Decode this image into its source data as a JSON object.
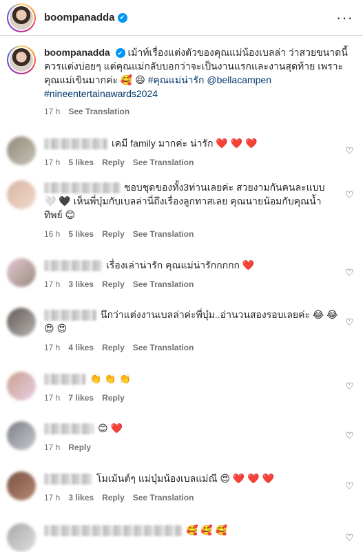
{
  "post_header": {
    "username": "boompanadda",
    "verified_icon": "✔",
    "more_icon": "···"
  },
  "caption": {
    "username": "boompanadda",
    "text": "เม้าท์เรื่องแต่งตัวของคุณแม่น้องเบลล่า ว่าสวยขนาดนี้ควรแต่งบ่อยๆ แต่คุณแม่กลับบอกว่าจะเป็นงานแรกและงานสุดท้าย เพราะคุณแม่เขินมากค่ะ 🥰 😆",
    "tags": [
      "#คุณแม่น่ารัก",
      "@bellacampen",
      "#nineentertainawards2024"
    ],
    "time": "17 h",
    "see_translation": "See Translation"
  },
  "comments": [
    {
      "text": "เคมี family มากค่ะ น่ารัก ❤️ ❤️ ❤️",
      "time": "17 h",
      "likes": "5 likes",
      "reply": "Reply",
      "see_translation": "See Translation",
      "avatar_colors": [
        "#8f8a7a",
        "#c9c3b5"
      ],
      "user_w": 92
    },
    {
      "text": "ชอบชุดของทั้ง3ท่านเลยค่ะ สวยงามกันคนละแบบ 🤍 🖤 เห็นพี่บุ๋มกับเบลล่านี่ถึงเรื่องลูกทาสเลย คุณนายน้อมกับคุณน้ำทิพย์ 😊",
      "time": "16 h",
      "likes": "5 likes",
      "reply": "Reply",
      "see_translation": "See Translation",
      "avatar_colors": [
        "#d7b6a3",
        "#f2d8cb"
      ],
      "user_w": 110
    },
    {
      "text": "เรื่องเล่าน่ารัก คุณแม่น่ารักกกกก ❤️",
      "time": "17 h",
      "likes": "3 likes",
      "reply": "Reply",
      "see_translation": "See Translation",
      "avatar_colors": [
        "#e4c7d4",
        "#9a8c7e"
      ],
      "user_w": 84
    },
    {
      "text": "นึกว่าแต่งงานเบลล่าค่ะพี่บุ๋ม..อ่านวนสองรอบเลยค่ะ 😂 😂 😍 😍",
      "time": "17 h",
      "likes": "4 likes",
      "reply": "Reply",
      "see_translation": "See Translation",
      "avatar_colors": [
        "#5f5a58",
        "#b9b3ae"
      ],
      "user_w": 76
    },
    {
      "text": "👏 👏 👏",
      "time": "17 h",
      "likes": "7 likes",
      "reply": "Reply",
      "see_translation": "",
      "avatar_colors": [
        "#c9a08c",
        "#e9cfe6"
      ],
      "user_w": 60
    },
    {
      "text": "😊 ❤️",
      "time": "17 h",
      "likes": "",
      "reply": "Reply",
      "see_translation": "",
      "avatar_colors": [
        "#7d7f87",
        "#c7c9cf"
      ],
      "user_w": 72
    },
    {
      "text": "โมเม้นต์ๆ แม่บุ๋มน้องเบลแม่ณี 😍 ❤️ ❤️ ❤️",
      "time": "17 h",
      "likes": "3 likes",
      "reply": "Reply",
      "see_translation": "See Translation",
      "avatar_colors": [
        "#7a5040",
        "#b58a74"
      ],
      "user_w": 70
    },
    {
      "text": "🥰 🥰 🥰",
      "time": "",
      "likes": "",
      "reply": "",
      "see_translation": "",
      "avatar_colors": [
        "#a9a9a9",
        "#dedede"
      ],
      "user_w": 200
    }
  ]
}
